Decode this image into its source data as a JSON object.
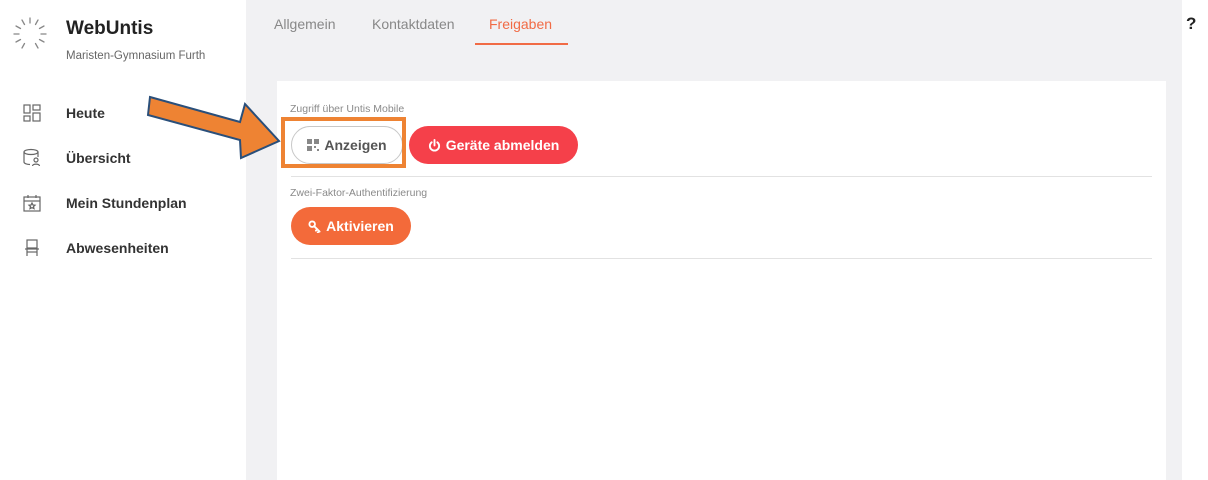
{
  "app": {
    "title": "WebUntis",
    "school": "Maristen-Gymnasium Furth"
  },
  "sidebar": {
    "items": [
      {
        "label": "Heute",
        "icon": "dashboard-icon"
      },
      {
        "label": "Übersicht",
        "icon": "database-user-icon"
      },
      {
        "label": "Mein Stundenplan",
        "icon": "calendar-star-icon"
      },
      {
        "label": "Abwesenheiten",
        "icon": "chair-icon"
      }
    ]
  },
  "tabs": [
    {
      "label": "Allgemein",
      "active": false
    },
    {
      "label": "Kontaktdaten",
      "active": false
    },
    {
      "label": "Freigaben",
      "active": true
    }
  ],
  "help_label": "?",
  "sections": {
    "mobile": {
      "label": "Zugriff über Untis Mobile",
      "show_button": "Anzeigen",
      "logout_button": "Geräte abmelden"
    },
    "twofactor": {
      "label": "Zwei-Faktor-Authentifizierung",
      "activate_button": "Aktivieren"
    }
  },
  "colors": {
    "accent": "#f16b45",
    "danger": "#f5404a",
    "activate": "#f36a3a",
    "annotation": "#ee8333"
  }
}
